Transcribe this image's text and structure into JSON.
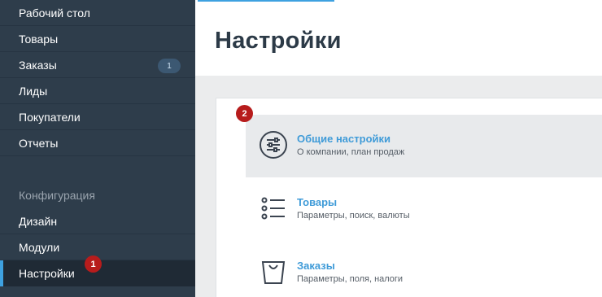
{
  "sidebar": {
    "items": [
      {
        "label": "Рабочий стол"
      },
      {
        "label": "Товары"
      },
      {
        "label": "Заказы",
        "badge": "1"
      },
      {
        "label": "Лиды"
      },
      {
        "label": "Покупатели"
      },
      {
        "label": "Отчеты"
      }
    ],
    "section_label": "Конфигурация",
    "config_items": [
      {
        "label": "Дизайн"
      },
      {
        "label": "Модули"
      },
      {
        "label": "Настройки"
      }
    ]
  },
  "markers": {
    "first": "1",
    "second": "2"
  },
  "page": {
    "title": "Настройки"
  },
  "settings": [
    {
      "title": "Общие настройки",
      "subtitle": "О компании, план продаж",
      "icon": "sliders-icon"
    },
    {
      "title": "Товары",
      "subtitle": "Параметры, поиск, валюты",
      "icon": "list-icon"
    },
    {
      "title": "Заказы",
      "subtitle": "Параметры, поля, налоги",
      "icon": "shopping-bag-icon"
    }
  ],
  "colors": {
    "sidebar": "#2e3d4b",
    "accent": "#3ea1e0",
    "link": "#3f9bd8",
    "marker": "#b71c1c"
  }
}
